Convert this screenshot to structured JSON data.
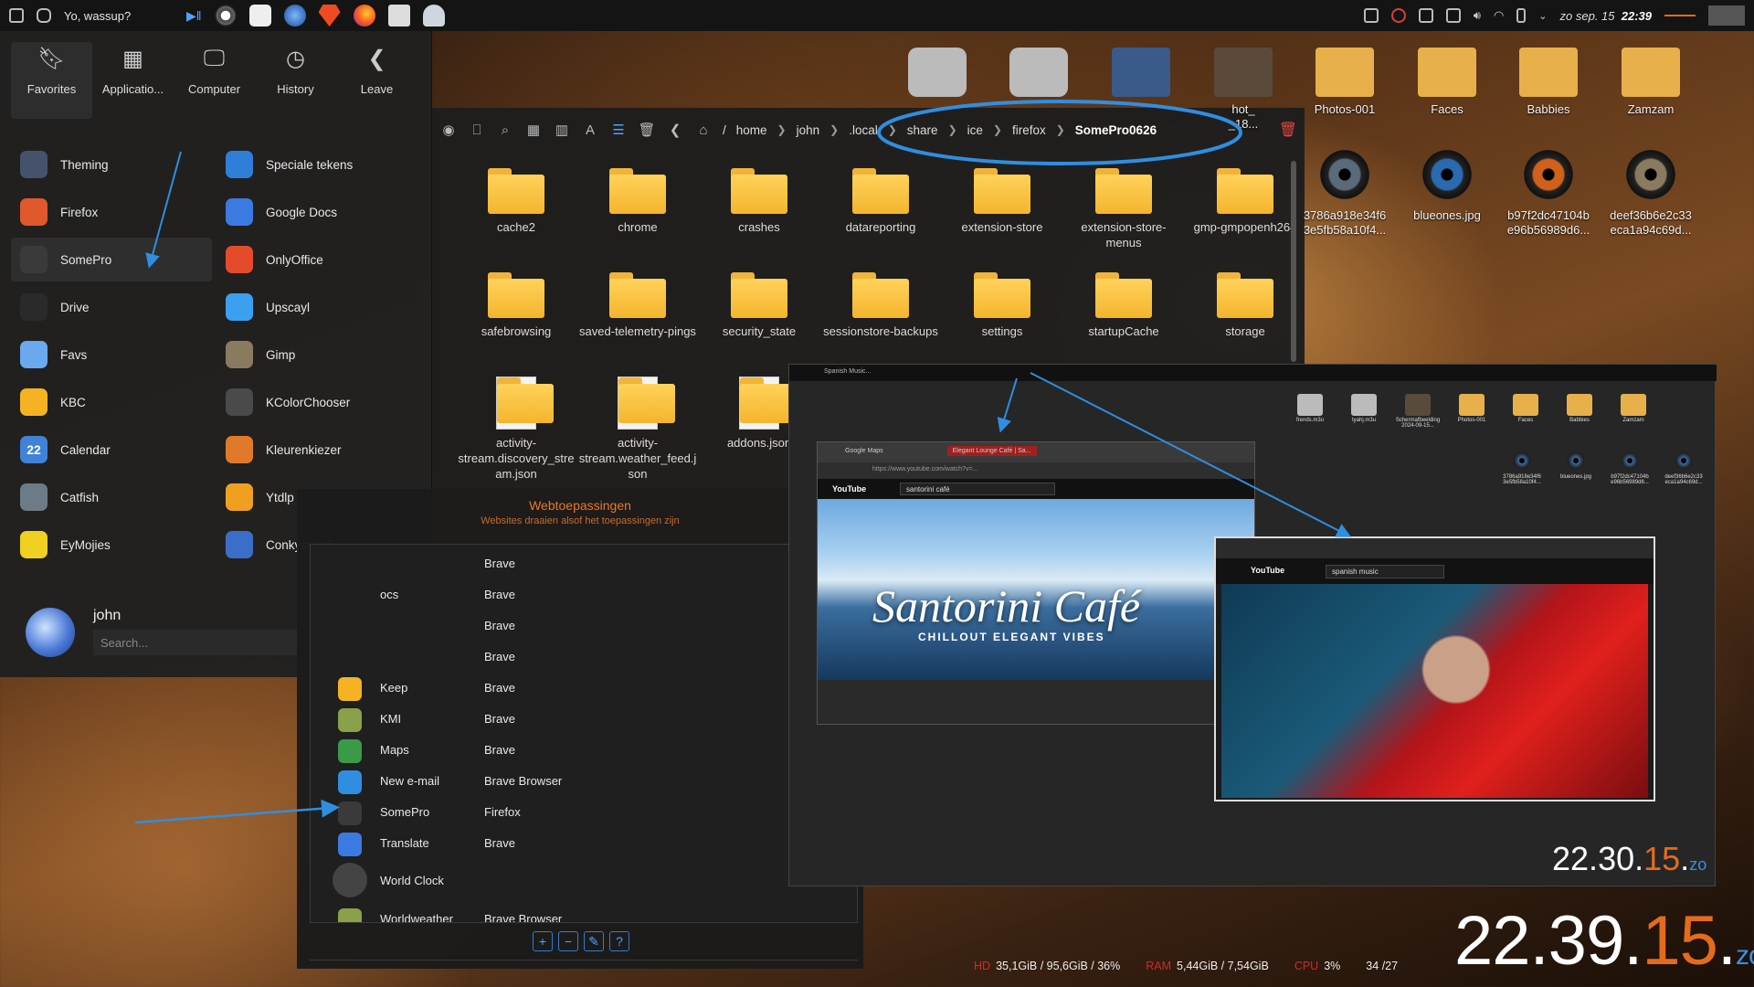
{
  "top_panel": {
    "window_title": "Yo, wassup?",
    "date": "zo sep. 15",
    "time": "22:39"
  },
  "launcher": {
    "tabs": [
      {
        "label": "Favorites"
      },
      {
        "label": "Applicatio..."
      },
      {
        "label": "Computer"
      },
      {
        "label": "History"
      },
      {
        "label": "Leave"
      }
    ],
    "left_items": [
      {
        "label": "Theming",
        "color": "#45526b"
      },
      {
        "label": "Firefox",
        "color": "#e0582c"
      },
      {
        "label": "SomePro",
        "color": "#3a3a3a"
      },
      {
        "label": "Drive",
        "color": "#2a2a2a"
      },
      {
        "label": "Favs",
        "color": "#6aa8f0"
      },
      {
        "label": "KBC",
        "color": "#f5b323"
      },
      {
        "label": "Calendar",
        "color": "#3f82d8"
      },
      {
        "label": "Catfish",
        "color": "#6d7a87"
      },
      {
        "label": "EyMojies",
        "color": "#f0d020"
      }
    ],
    "right_items": [
      {
        "label": "Speciale tekens",
        "color": "#2f7ed8"
      },
      {
        "label": "Google Docs",
        "color": "#3b7ae0"
      },
      {
        "label": "OnlyOffice",
        "color": "#e44b2a"
      },
      {
        "label": "Upscayl",
        "color": "#3ba0f0"
      },
      {
        "label": "Gimp",
        "color": "#8a7a60"
      },
      {
        "label": "KColorChooser",
        "color": "#4a4a4a"
      },
      {
        "label": "Kleurenkiezer",
        "color": "#e07a2a"
      },
      {
        "label": "Ytdlp",
        "color": "#f0a020"
      },
      {
        "label": "Conkyswitch",
        "color": "#3a6ec8"
      }
    ],
    "calendar_day": "22",
    "user_name": "john",
    "search_placeholder": "Search..."
  },
  "file_manager": {
    "breadcrumbs": [
      "/",
      "home",
      "john",
      ".local",
      "share",
      "ice",
      "firefox",
      "SomePro0626"
    ],
    "items": [
      {
        "name": "cache2",
        "type": "folder"
      },
      {
        "name": "chrome",
        "type": "folder"
      },
      {
        "name": "crashes",
        "type": "folder"
      },
      {
        "name": "datareporting",
        "type": "folder"
      },
      {
        "name": "extension-store",
        "type": "folder"
      },
      {
        "name": "extension-store-menus",
        "type": "folder"
      },
      {
        "name": "gmp-gmpopenh264",
        "type": "folder"
      },
      {
        "name": "safebrowsing",
        "type": "folder"
      },
      {
        "name": "saved-telemetry-pings",
        "type": "folder"
      },
      {
        "name": "security_state",
        "type": "folder"
      },
      {
        "name": "sessionstore-backups",
        "type": "folder"
      },
      {
        "name": "settings",
        "type": "folder"
      },
      {
        "name": "startupCache",
        "type": "folder"
      },
      {
        "name": "storage",
        "type": "folder"
      },
      {
        "name": "activity-stream.discovery_stream.json",
        "type": "file"
      },
      {
        "name": "activity-stream.weather_feed.json",
        "type": "file"
      },
      {
        "name": "addons.json",
        "type": "file"
      }
    ]
  },
  "webapps": {
    "title": "Webtoepassingen",
    "subtitle": "Websites draaien alsof het toepassingen zijn",
    "rows": [
      {
        "name": "",
        "browser": "Brave",
        "color": "transparent"
      },
      {
        "name": "ocs",
        "browser": "Brave",
        "color": "transparent"
      },
      {
        "name": "",
        "browser": "Brave",
        "color": "transparent"
      },
      {
        "name": "",
        "browser": "Brave",
        "color": "transparent"
      },
      {
        "name": "Keep",
        "browser": "Brave",
        "color": "#f5b323"
      },
      {
        "name": "KMI",
        "browser": "Brave",
        "color": "#8aa04a"
      },
      {
        "name": "Maps",
        "browser": "Brave",
        "color": "#3a9a4a"
      },
      {
        "name": "New e-mail",
        "browser": "Brave Browser",
        "color": "#2f8ee0"
      },
      {
        "name": "SomePro",
        "browser": "Firefox",
        "color": "#3a3a3a"
      },
      {
        "name": "Translate",
        "browser": "Brave",
        "color": "#3b7ae0"
      },
      {
        "name": "World Clock",
        "browser": "",
        "color": "#444"
      },
      {
        "name": "Worldweather",
        "browser": "Brave Browser",
        "color": "#8aa04a"
      }
    ],
    "buttons": [
      "+",
      "−",
      "✎",
      "?"
    ]
  },
  "desktop_icons": {
    "top": [
      {
        "label": "",
        "color": "#bbbbbb"
      },
      {
        "label": "",
        "color": "#bbbbbb"
      },
      {
        "label": "",
        "color": "#3a5a8a"
      },
      {
        "label": "hot_\n_18...",
        "color": "#5a4a3a"
      },
      {
        "label": "Photos-001",
        "color": "#e8b04a"
      },
      {
        "label": "Faces",
        "color": "#e8b04a"
      },
      {
        "label": "Babbies",
        "color": "#e8b04a"
      },
      {
        "label": "Zamzam",
        "color": "#e8b04a"
      }
    ],
    "eyes": [
      {
        "label": "3786a918e34f6 3e5fb58a10f4...",
        "color": "#5a6a7a"
      },
      {
        "label": "blueones.jpg",
        "color": "#2a6ab0"
      },
      {
        "label": "b97f2dc47104b e96b56989d6...",
        "color": "#d0601a"
      },
      {
        "label": "deef36b6e2c33 eca1a94c69d...",
        "color": "#8a7a60"
      }
    ]
  },
  "screenshot": {
    "top_title": "Spanish Music...",
    "brave_tab1": "Google Maps",
    "brave_tab2": "Elegant Lounge Café | Sa...",
    "brave_url": "https://www.youtube.com/watch?v=...",
    "yt_search1": "santorini café",
    "yt_logo": "YouTube",
    "video1_title": "Santorini Café",
    "video1_sub": "CHILLOUT ELEGANT VIBES",
    "yt_search2": "spanish music",
    "clock": {
      "h": "22",
      "m": "30",
      "s": "15",
      "d": "zo"
    },
    "mini_icons": [
      "frends.m3u",
      "tyahj.m3u",
      "Schermafbeelding 2024-09-15...",
      "Photos-001",
      "Faces",
      "Babbies",
      "Zamzam"
    ],
    "mini_eyes": [
      "3786a918e34f6 3e5fb58a10f4...",
      "blueones.jpg",
      "b97f2dc47104b e96b56989d6...",
      "deef36b6e2c33 eca1a94c69d..."
    ]
  },
  "big_clock": {
    "h": "22",
    "m": "39",
    "s": "15",
    "d": "zo"
  },
  "stats": {
    "hd_label": "HD",
    "hd_value": "35,1GiB / 95,6GiB / 36%",
    "ram_label": "RAM",
    "ram_value": "5,44GiB / 7,54GiB",
    "cpu_label": "CPU",
    "cpu_value": "3%",
    "temp_value": "34",
    "temp_value2": "/27"
  },
  "colors": {
    "accent": "#e46b1c",
    "annotation": "#2f8ee0",
    "folder": "#f4b52e"
  }
}
